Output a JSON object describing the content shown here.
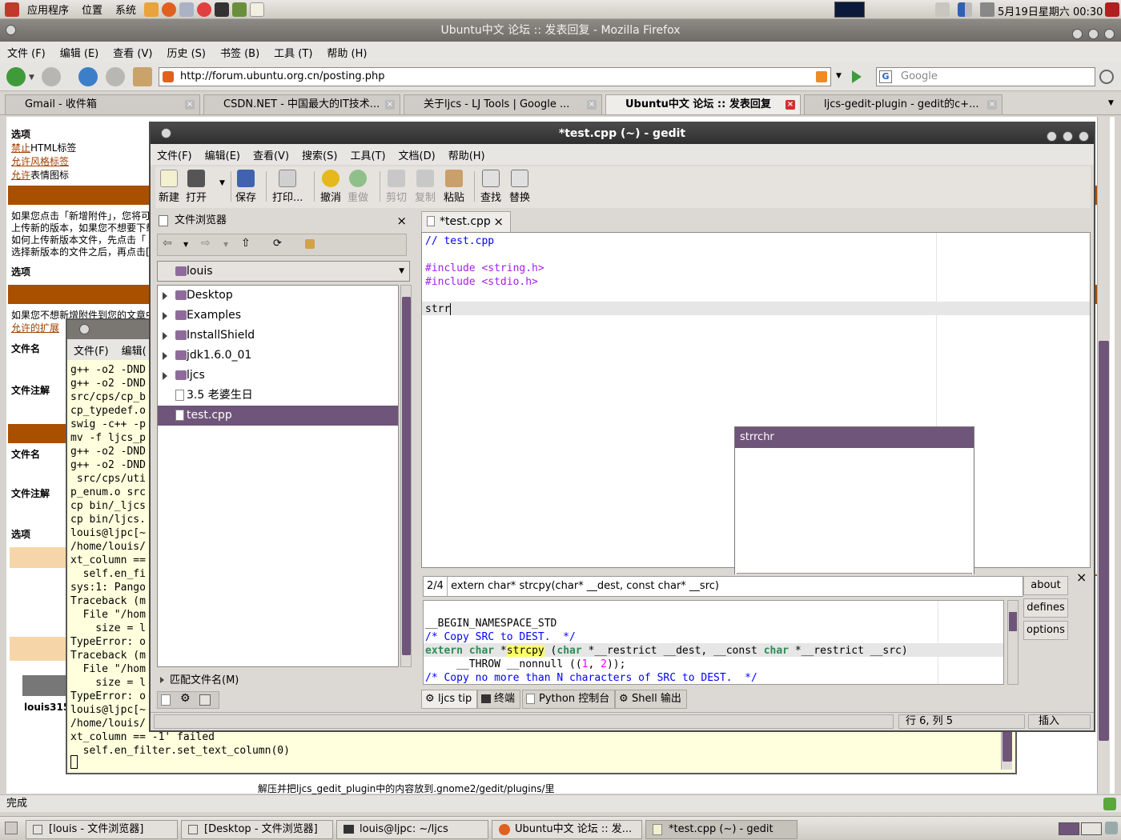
{
  "top_panel": {
    "apps": "应用程序",
    "places": "位置",
    "system": "系统",
    "clock": "5月19日星期六 00:30"
  },
  "firefox": {
    "title": "Ubuntu中文 论坛 :: 发表回复 - Mozilla Firefox",
    "menu": [
      "文件 (F)",
      "编辑 (E)",
      "查看 (V)",
      "历史 (S)",
      "书签 (B)",
      "工具 (T)",
      "帮助 (H)"
    ],
    "url": "http://forum.ubuntu.org.cn/posting.php",
    "search_placeholder": "Google",
    "tabs": [
      "Gmail - 收件箱",
      "CSDN.NET - 中国最大的IT技术...",
      "关于ljcs - LJ Tools | Google ...",
      "Ubuntu中文 论坛 :: 发表回复",
      "ljcs-gedit-plugin - gedit的c+..."
    ],
    "status": "完成"
  },
  "forum_page": {
    "options1": "选项",
    "opt_html_prefix": "禁止",
    "opt_html": "HTML标签",
    "opt_bbcode_prefix": "允许",
    "opt_bbcode": "风格标签",
    "opt_smilies_prefix": "允许",
    "opt_smilies": "表情图标",
    "attach_help": [
      "如果您点击「新增附件」，您将可",
      "上传新的版本，如果您不想要下载",
      "如何上传新版本文件，先点击「",
      "选择新版本的文件之后，再点击["
    ],
    "options2": "选项",
    "attach_note": "如果您不想新增附件到您的文章中",
    "allowed_ext": "允许的扩展",
    "filename1": "文件名",
    "file_comment1": "文件注解",
    "filename2": "文件名",
    "file_comment2": "文件注解",
    "options3": "选项",
    "user": "louis315",
    "bottom_text": "解压并把ljcs_gedit_plugin中的内容放到.gnome2/gedit/plugins/里"
  },
  "terminal": {
    "menu": [
      "文件(F)",
      "编辑("
    ],
    "lines": [
      "g++ -o2 -DND",
      "g++ -o2 -DND",
      "src/cps/cp_b",
      "cp_typedef.o",
      "swig -c++ -p",
      "mv -f ljcs_p",
      "g++ -o2 -DND",
      "g++ -o2 -DND",
      " src/cps/uti",
      "p_enum.o src",
      "cp bin/_ljcs",
      "cp bin/ljcs.",
      "louis@ljpc[~",
      "/home/louis/",
      "xt_column ==",
      "  self.en_fi",
      "sys:1: Pango",
      "Traceback (m",
      "  File \"/hom",
      "    size = l",
      "TypeError: o",
      "Traceback (m",
      "  File \"/hom",
      "    size = l",
      "TypeError: o",
      "louis@ljpc[~",
      "/home/louis/",
      "xt_column == -1' failed",
      "  self.en_filter.set_text_column(0)"
    ]
  },
  "gedit": {
    "title": "*test.cpp (~) - gedit",
    "menu": [
      "文件(F)",
      "编辑(E)",
      "查看(V)",
      "搜索(S)",
      "工具(T)",
      "文档(D)",
      "帮助(H)"
    ],
    "toolbar": {
      "new": "新建",
      "open": "打开",
      "save": "保存",
      "print": "打印...",
      "undo": "撤消",
      "redo": "重做",
      "cut": "剪切",
      "copy": "复制",
      "paste": "粘贴",
      "find": "查找",
      "replace": "替换"
    },
    "side_panel": {
      "title": "文件浏览器",
      "location": "louis",
      "items": [
        {
          "name": "Desktop",
          "kind": "folder"
        },
        {
          "name": "Examples",
          "kind": "folder"
        },
        {
          "name": "InstallShield",
          "kind": "folder"
        },
        {
          "name": "jdk1.6.0_01",
          "kind": "folder"
        },
        {
          "name": "ljcs",
          "kind": "folder"
        },
        {
          "name": "3.5 老婆生日",
          "kind": "file"
        },
        {
          "name": "test.cpp",
          "kind": "file",
          "selected": true
        }
      ],
      "filter_label": "匹配文件名(M)"
    },
    "doc_tab": "*test.cpp",
    "code": {
      "line1": "// test.cpp",
      "line3": "#include <string.h>",
      "line4": "#include <stdio.h>",
      "line6": "strr"
    },
    "completion": {
      "selected": "strrchr"
    },
    "tip": {
      "counter": "2/4",
      "signature": "extern char* strcpy(char* __dest, const char* __src)",
      "buttons": {
        "about": "about",
        "defines": "defines",
        "options": "options"
      },
      "code1": "__BEGIN_NAMESPACE_STD",
      "code2": "/* Copy SRC to DEST.  */",
      "code3_kw": "extern",
      "code3_ty": "char",
      "code3_hl": "strcpy",
      "code3_a": " (",
      "code3_ty2": "char",
      "code3_b": " *__restrict __dest, __const ",
      "code3_ty3": "char",
      "code3_c": " *__restrict __src)",
      "code4_a": "     __THROW __nonnull ((",
      "code4_n1": "1",
      "code4_sep": ", ",
      "code4_n2": "2",
      "code4_b": "));",
      "code5": "/* Copy no more than N characters of SRC to DEST.  */"
    },
    "bottom_tabs": [
      "ljcs tip",
      "终端",
      "Python 控制台",
      "Shell 输出"
    ],
    "status": {
      "position": "行 6, 列 5",
      "mode": "插入"
    }
  },
  "taskbar": [
    "[louis - 文件浏览器]",
    "[Desktop - 文件浏览器]",
    "louis@ljpc: ~/ljcs",
    "Ubuntu中文 论坛 :: 发...",
    "*test.cpp (~) - gedit"
  ]
}
